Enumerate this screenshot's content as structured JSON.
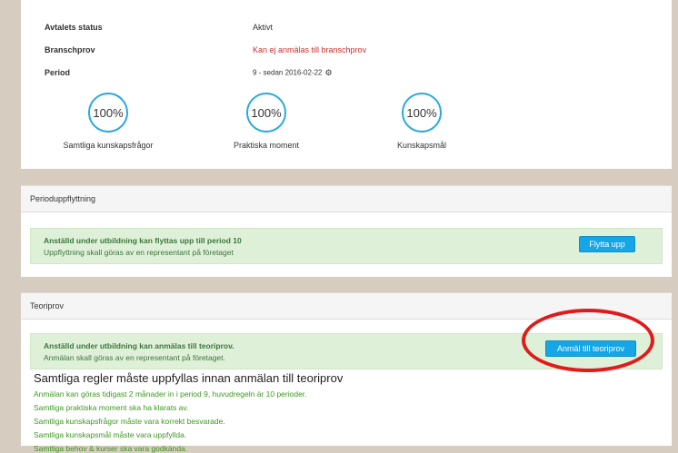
{
  "summary": {
    "rows": [
      {
        "label": "Avtalets status",
        "value": "Aktivt"
      },
      {
        "label": "Branschprov",
        "value": "Kan ej anmälas till branschprov"
      },
      {
        "label": "Period",
        "value": "9 - sedan 2016-02-22"
      }
    ],
    "progress": [
      {
        "value_text": "100%",
        "percent": 100,
        "label": "Samtliga kunskapsfrågor"
      },
      {
        "value_text": "100%",
        "percent": 100,
        "label": "Praktiska moment"
      },
      {
        "value_text": "100%",
        "percent": 100,
        "label": "Kunskapsmål"
      }
    ]
  },
  "perioduppflyttning": {
    "heading": "Perioduppflyttning",
    "alert_title": "Anställd under utbildning kan flyttas upp till period 10",
    "alert_text": "Uppflyttning skall göras av en representant på företaget",
    "button": "Flytta upp"
  },
  "teoriprov": {
    "heading": "Teoriprov",
    "alert_title": "Anställd under utbildning kan anmälas till teoriprov.",
    "alert_text": "Anmälan skall göras av en representant på företaget.",
    "button": "Anmäl till teoriprov",
    "rules_title": "Samtliga regler måste uppfyllas innan anmälan till teoriprov",
    "rules": [
      "Anmälan kan göras tidigast 2 månader in i period 9, huvudregeln är 10 perioder.",
      "Samtliga praktiska moment ska ha klarats av.",
      "Samtliga kunskapsfrågor måste vara korrekt besvarade.",
      "Samtliga kunskapsmål måste vara uppfyllda.",
      "Samtliga behov & kurser ska vara godkända."
    ]
  },
  "colors": {
    "accent": "#14a6e6",
    "alert_bg": "#dff0d8",
    "alert_text": "#3c763d",
    "highlight": "#e01b1b",
    "error_text": "#c9302c"
  }
}
